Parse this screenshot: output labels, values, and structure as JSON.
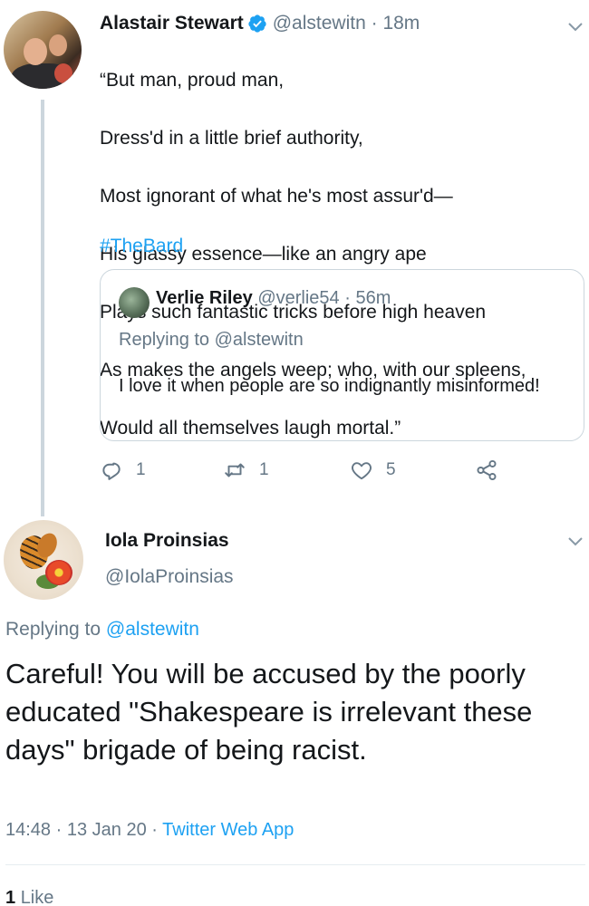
{
  "original_tweet": {
    "author_name": "Alastair Stewart",
    "handle": "@alstewitn",
    "separator": "·",
    "time": "18m",
    "verified_icon": "verified-badge-icon",
    "lines": [
      "“But man, proud man,",
      "Dress'd in a little brief authority,",
      "Most ignorant of what he's most assur'd—",
      "His glassy essence—like an angry ape",
      "Plays such fantastic tricks before high heaven",
      "As makes the angels weep; who, with our spleens,",
      "Would all themselves laugh mortal.”"
    ],
    "hashtag": "#TheBard",
    "quoted": {
      "author_name": "Verlie Riley",
      "handle": "@verlie54",
      "separator": "·",
      "time": "56m",
      "replying_prefix": "Replying to",
      "replying_to": "@alstewitn",
      "text": "I love it when people are so indignantly misinformed!"
    },
    "actions": {
      "reply_count": "1",
      "retweet_count": "1",
      "like_count": "5"
    }
  },
  "reply_tweet": {
    "author_name": "Iola Proinsias",
    "handle": "@IolaProinsias",
    "replying_prefix": "Replying to",
    "replying_to": "@alstewitn",
    "text": "Careful!  You will be accused by the poorly educated \"Shakespeare is irrelevant these days\" brigade of being racist.",
    "time": "14:48",
    "separator1": "·",
    "date": "13 Jan 20",
    "separator2": "·",
    "source_app": "Twitter Web App",
    "like_count": "1",
    "like_label": "Like"
  },
  "colors": {
    "accent": "#1da1f2",
    "text_primary": "#14171a",
    "text_secondary": "#657786",
    "border": "#ccd6dd"
  }
}
